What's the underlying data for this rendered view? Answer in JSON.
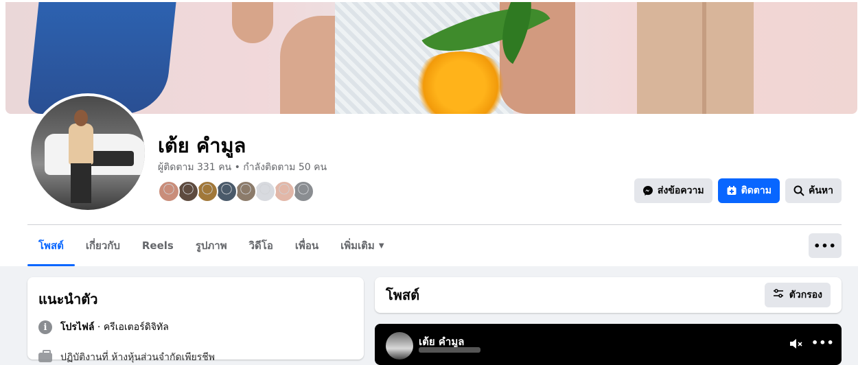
{
  "profile": {
    "name": "เต้ย คำมูล",
    "follow_stats": "ผู้ติดตาม 331 คน • กำลังติดตาม 50 คน",
    "friend_avatar_colors": [
      "#c98d7a",
      "#5e4b3f",
      "#a1783a",
      "#4a5a6a",
      "#8c7b6a",
      "#d8dadf",
      "#e2b7a8",
      "#8a8d91"
    ]
  },
  "actions": {
    "message_label": "ส่งข้อความ",
    "follow_label": "ติดตาม",
    "search_label": "ค้นหา"
  },
  "tabs": [
    {
      "label": "โพสต์"
    },
    {
      "label": "เกี่ยวกับ"
    },
    {
      "label": "Reels"
    },
    {
      "label": "รูปภาพ"
    },
    {
      "label": "วิดีโอ"
    },
    {
      "label": "เพื่อน"
    },
    {
      "label": "เพิ่มเติม"
    }
  ],
  "more_button": "•••",
  "intro": {
    "title": "แนะนำตัว",
    "profile_label": "โปรไฟล์",
    "profile_value": " · ครีเอเตอร์ดิจิทัล",
    "work_partial": "ปฏิบัติงานที่ ห้างหุ้นส่วนจำกัดเพียรชีพ"
  },
  "posts": {
    "title": "โพสต์",
    "filter_label": "ตัวกรอง"
  },
  "reel": {
    "author": "เต้ย คำมูล",
    "more": "•••"
  },
  "colors": {
    "accent": "#0866ff",
    "button_grey": "#e4e6eb",
    "secondary_text": "#65676b",
    "page_bg": "#f0f2f5"
  }
}
